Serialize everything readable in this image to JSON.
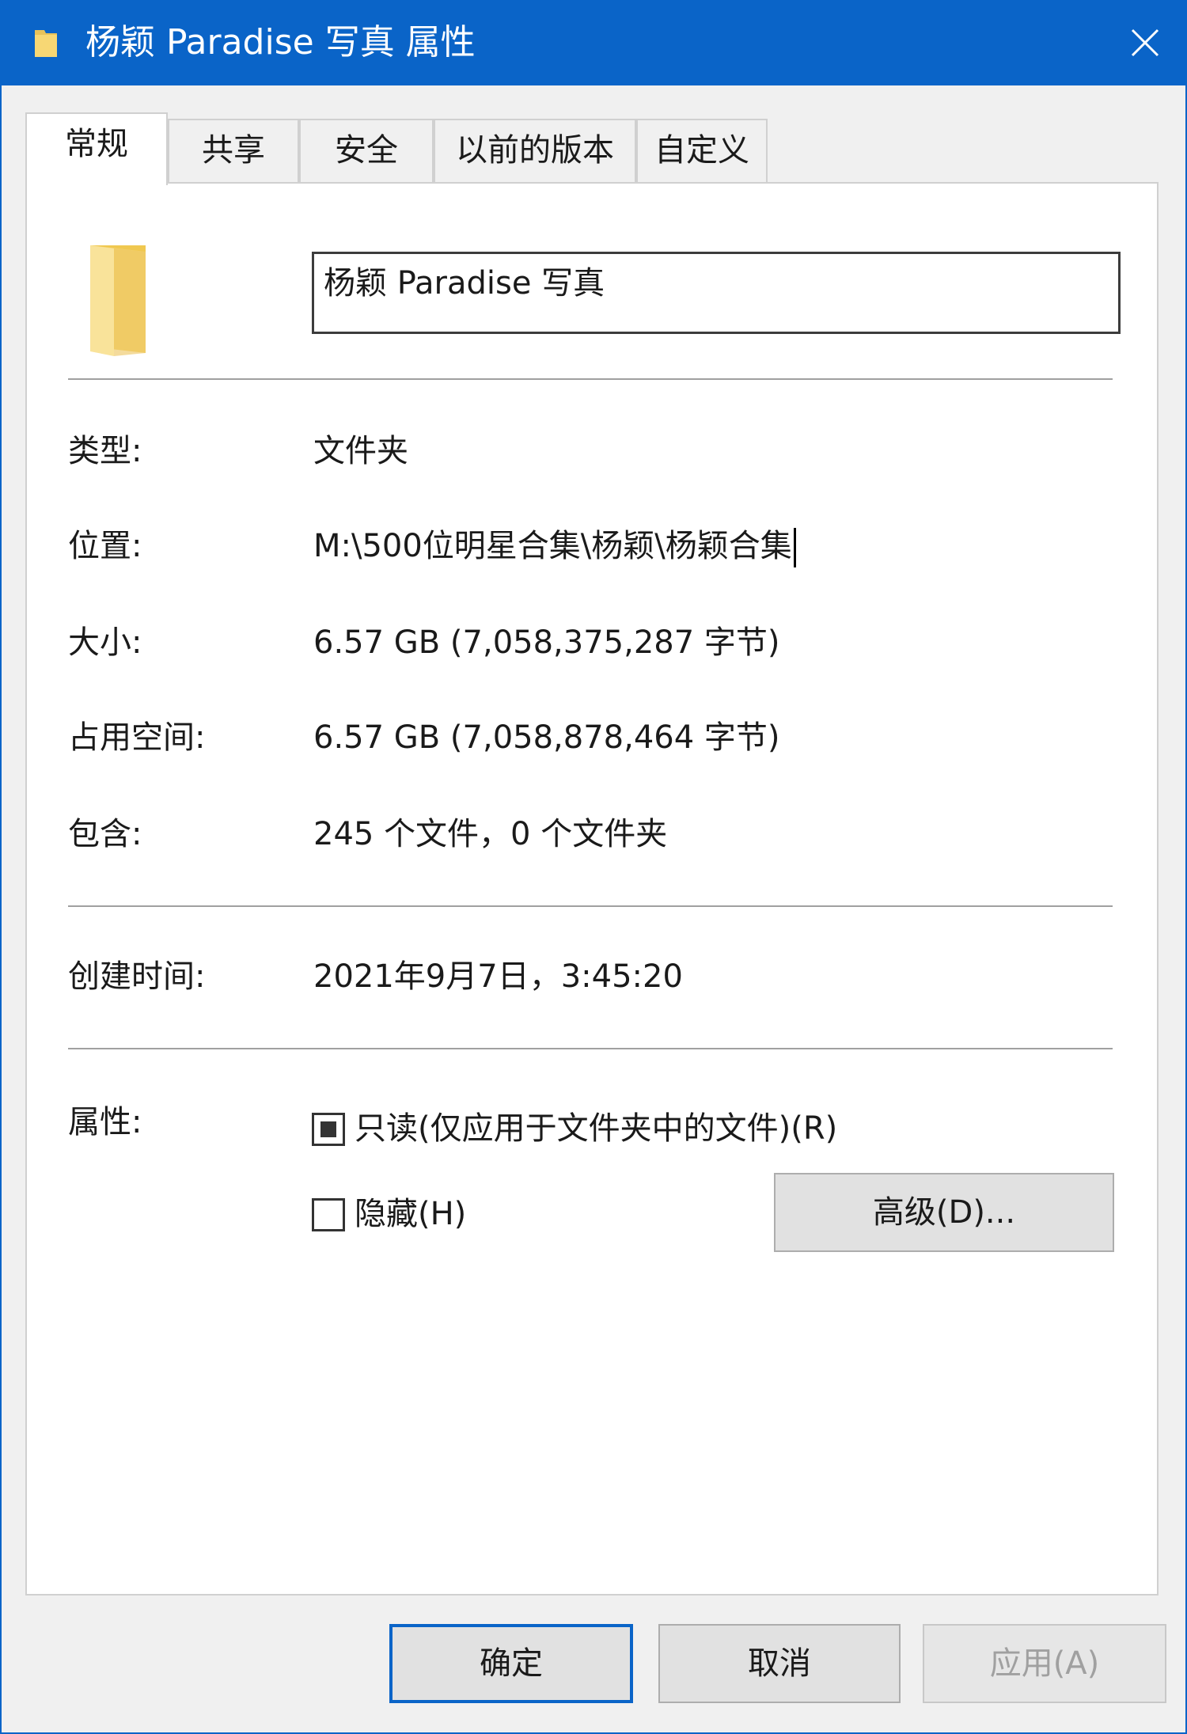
{
  "window": {
    "title": "杨颖 Paradise 写真 属性",
    "title_icon": "folder-icon",
    "close_icon": "close-icon",
    "accent_color": "#0a64c8"
  },
  "tabs": [
    {
      "label": "常规",
      "active": true
    },
    {
      "label": "共享",
      "active": false
    },
    {
      "label": "安全",
      "active": false
    },
    {
      "label": "以前的版本",
      "active": false
    },
    {
      "label": "自定义",
      "active": false
    }
  ],
  "general": {
    "folder_icon": "folder-icon",
    "name_value": "杨颖 Paradise 写真",
    "type_label": "类型:",
    "type_value": "文件夹",
    "location_label": "位置:",
    "location_value": "M:\\500位明星合集\\杨颖\\杨颖合集",
    "size_label": "大小:",
    "size_value": "6.57 GB (7,058,375,287 字节)",
    "disk_size_label": "占用空间:",
    "disk_size_value": "6.57 GB (7,058,878,464 字节)",
    "contains_label": "包含:",
    "contains_value": "245 个文件，0 个文件夹",
    "created_label": "创建时间:",
    "created_value": "2021年9月7日，3:45:20",
    "attributes_label": "属性:",
    "readonly_label": "只读(仅应用于文件夹中的文件)(R)",
    "readonly_state": "indeterminate",
    "hidden_label": "隐藏(H)",
    "hidden_checked": false,
    "advanced_button": "高级(D)..."
  },
  "footer": {
    "ok_label": "确定",
    "cancel_label": "取消",
    "apply_label": "应用(A)"
  }
}
